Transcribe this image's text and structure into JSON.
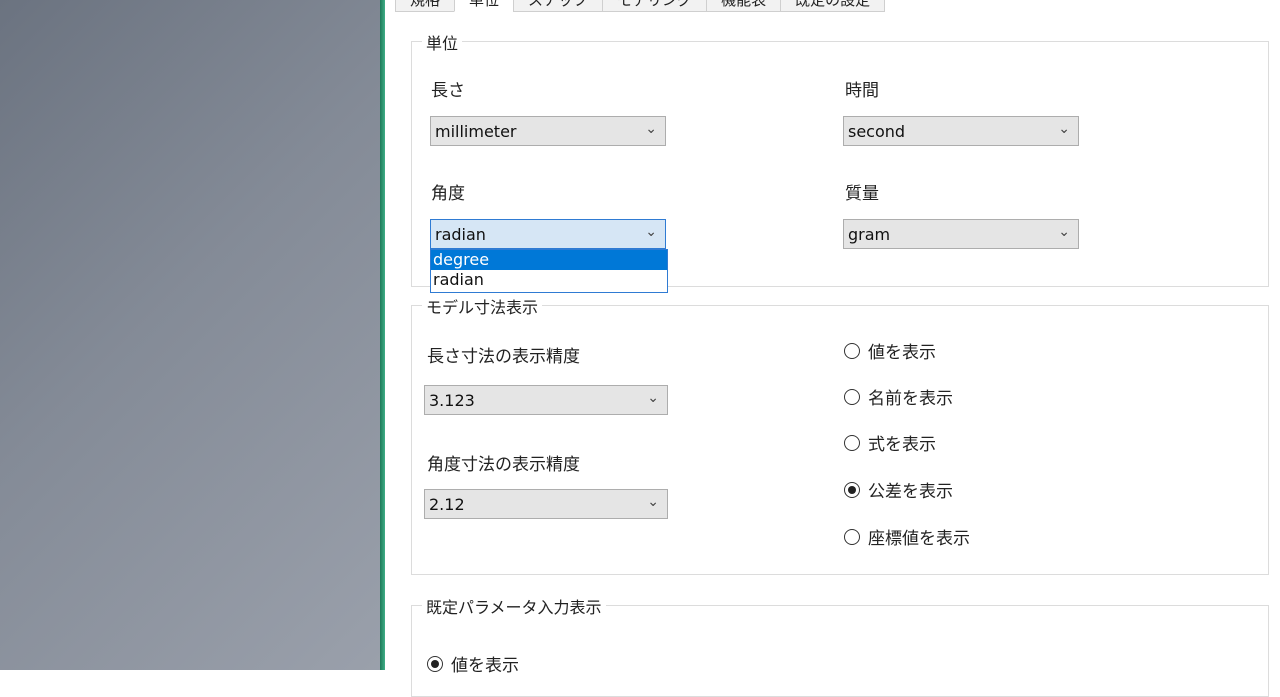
{
  "tabs": [
    "規格",
    "単位",
    "スナップ",
    "モデリング",
    "機能表",
    "既定の設定"
  ],
  "units_group": {
    "legend": "単位",
    "length": {
      "label": "長さ",
      "value": "millimeter"
    },
    "time": {
      "label": "時間",
      "value": "second"
    },
    "angle": {
      "label": "角度",
      "value": "radian",
      "options": [
        "degree",
        "radian"
      ],
      "highlighted": "degree"
    },
    "mass": {
      "label": "質量",
      "value": "gram"
    }
  },
  "model_dim_group": {
    "legend": "モデル寸法表示",
    "length_precision": {
      "label": "長さ寸法の表示精度",
      "value": "3.123"
    },
    "angle_precision": {
      "label": "角度寸法の表示精度",
      "value": "2.12"
    },
    "radios": [
      {
        "label": "値を表示",
        "checked": false
      },
      {
        "label": "名前を表示",
        "checked": false
      },
      {
        "label": "式を表示",
        "checked": false
      },
      {
        "label": "公差を表示",
        "checked": true
      },
      {
        "label": "座標値を表示",
        "checked": false
      }
    ]
  },
  "param_group": {
    "legend": "既定パラメータ入力表示",
    "radios": [
      {
        "label": "値を表示",
        "checked": true
      }
    ]
  },
  "icons": {
    "dropdown": "chevron-down-icon",
    "radio": "radio-icon"
  },
  "colors": {
    "accent": "#0078d7",
    "focus_bg": "#d6e6f5",
    "window_edge": "#2a9a72"
  }
}
